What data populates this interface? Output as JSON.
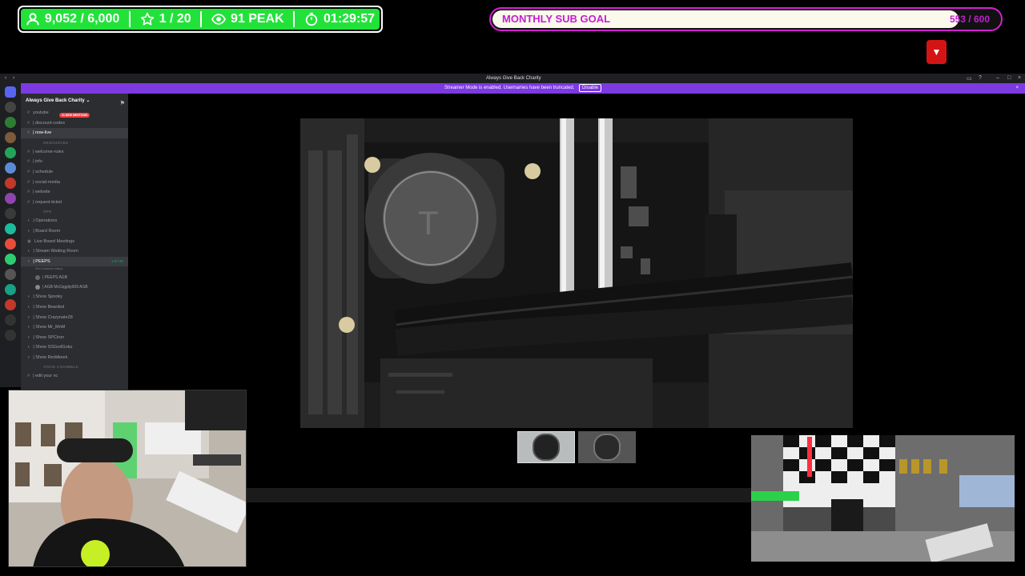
{
  "overlay": {
    "stats": {
      "followers": "9,052 / 6,000",
      "subs": "1 / 20",
      "viewers": "91 PEAK",
      "uptime": "01:29:57"
    },
    "sub_goal": {
      "label": "MONTHLY SUB GOAL",
      "count": "553 / 600",
      "progress": 0.92
    }
  },
  "discord": {
    "window_title": "Always Give Back Charity",
    "banner": {
      "text": "Streamer Mode is enabled. Usernames have been truncated.",
      "button": "Disable"
    },
    "server_name": "Always Give Back Charity",
    "mentions_pill": "41 NEW MENTIONS",
    "top_channels": [
      "youtube",
      "| discount-codes",
      "| now-live"
    ],
    "resources_header": "RESOURCES",
    "resources": [
      "| welcome-rules",
      "| info",
      "| schedule",
      "| social-media",
      "| website",
      "| request-ticket"
    ],
    "ops_header": "OPS",
    "ops": [
      "| Operations",
      "| Board Room",
      "Live Board Meetings",
      "| Stream Waiting Room"
    ],
    "peeps": {
      "name": "| PEEPS",
      "time": "1:07:48",
      "status": "Set a channel status",
      "members": [
        "| PEEPS  AGB",
        "| AGB McGiggity009  AGB"
      ]
    },
    "shows": [
      "| Show Spooky",
      "| Show Bearded",
      "| Show Crazynate28",
      "| Show Mr_MnM",
      "| Show SPCiron",
      "| Show SSGodGoku",
      "| Show Reddkeek"
    ],
    "voice_header": "VOICE CHANNELS",
    "voice": [
      "| edit your vc"
    ]
  },
  "icons": {
    "followers": "person-icon",
    "subs": "star-icon",
    "viewers": "eye-icon",
    "uptime": "stopwatch-icon"
  },
  "colors": {
    "stats_green": "#22e23a",
    "goal_magenta": "#c21ecf",
    "discord_purple": "#7c3ae0",
    "alert_red": "#d41414"
  }
}
